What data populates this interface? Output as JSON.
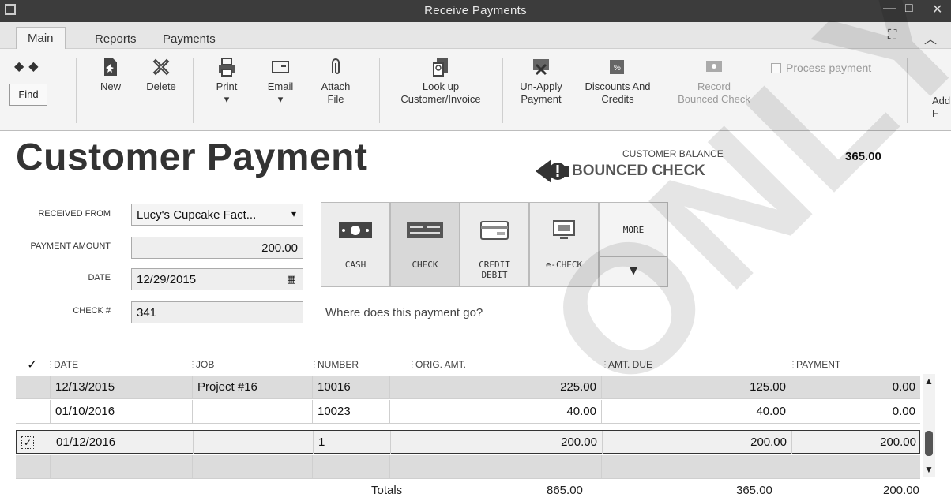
{
  "window": {
    "title": "Receive Payments"
  },
  "tabs": [
    {
      "label": "Main",
      "active": true
    },
    {
      "label": "Reports",
      "active": false
    },
    {
      "label": "Payments",
      "active": false
    }
  ],
  "toolbar": {
    "find": "Find",
    "new": "New",
    "delete": "Delete",
    "print": "Print",
    "email": "Email",
    "attach": [
      "Attach",
      "File"
    ],
    "lookup": [
      "Look up",
      "Customer/Invoice"
    ],
    "unapply": [
      "Un-Apply",
      "Payment"
    ],
    "discounts": [
      "Discounts And",
      "Credits"
    ],
    "record": [
      "Record",
      "Bounced Check"
    ],
    "process_payment": "Process payment",
    "add_partial": [
      "Add",
      "F"
    ]
  },
  "header": {
    "title": "Customer Payment",
    "status": "BOUNCED CHECK",
    "balance_label": "CUSTOMER BALANCE",
    "balance_value": "365.00"
  },
  "form": {
    "received_from_label": "RECEIVED FROM",
    "received_from_value": "Lucy's Cupcake Fact...",
    "payment_amount_label": "PAYMENT AMOUNT",
    "payment_amount_value": "200.00",
    "date_label": "DATE",
    "date_value": "12/29/2015",
    "check_label": "CHECK #",
    "check_value": "341"
  },
  "payment_methods": {
    "cash": "CASH",
    "check": "CHECK",
    "credit": [
      "CREDIT",
      "DEBIT"
    ],
    "echeck": "e-CHECK",
    "more": "MORE",
    "selected": "CHECK"
  },
  "where_text": "Where does this payment go?",
  "table": {
    "headers": {
      "check": "✓",
      "date": "DATE",
      "job": "JOB",
      "number": "NUMBER",
      "orig": "ORIG. AMT.",
      "due": "AMT. DUE",
      "payment": "PAYMENT"
    },
    "rows": [
      {
        "checked": "",
        "date": "12/13/2015",
        "job": "Project #16",
        "number": "10016",
        "orig": "225.00",
        "due": "125.00",
        "payment": "0.00"
      },
      {
        "checked": "",
        "date": "01/10/2016",
        "job": "",
        "number": "10023",
        "orig": "40.00",
        "due": "40.00",
        "payment": "0.00"
      },
      {
        "checked": "✓",
        "date": "01/12/2016",
        "job": "",
        "number": "1",
        "orig": "200.00",
        "due": "200.00",
        "payment": "200.00"
      },
      {
        "checked": "",
        "date": "",
        "job": "",
        "number": "",
        "orig": "",
        "due": "",
        "payment": ""
      }
    ],
    "totals": {
      "label": "Totals",
      "orig": "865.00",
      "due": "365.00",
      "payment": "200.00"
    }
  },
  "watermark": "ONLY",
  "colors": {
    "titlebar": "#3c3c3c",
    "toolbar": "#f4f4f4",
    "highlight_row": "#dcdcdc"
  }
}
